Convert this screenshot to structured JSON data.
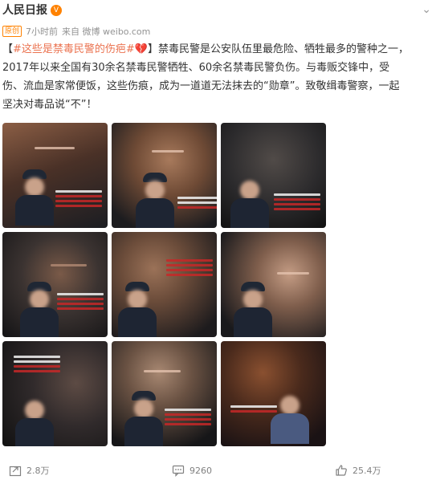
{
  "post": {
    "username": "人民日报",
    "badge_label": "原创",
    "time": "7小时前",
    "source": "来自 微博 weibo.com",
    "text_prefix": "【",
    "hashtag": "#这些是禁毒民警的伤疤#",
    "text_body_1": "】禁毒民警是公安队伍里最危险、牺牲最多的警种之一，",
    "text_body_2": "2017年以来全国有30余名禁毒民警牺牲、60余名禁毒民警负伤。与毒贩交锋中，受",
    "text_body_3": "伤、流血是家常便饭，这些伤痕，成为一道道无法抹去的“勋章”。致敬缉毒警察，一起",
    "text_body_4": "坚决对毒品说“不”！"
  },
  "icons": {
    "vip": "vip-badge-icon",
    "heart": "broken-heart-icon",
    "menu": "chevron-down-icon",
    "repost": "repost-icon",
    "comment": "comment-icon",
    "like": "thumbs-up-icon"
  },
  "actions": {
    "repost_count": "2.8万",
    "comment_count": "9260",
    "like_count": "25.4万"
  },
  "colors": {
    "accent_orange": "#ff8200",
    "hashtag": "#eb7350",
    "text": "#333333",
    "meta": "#939393"
  }
}
